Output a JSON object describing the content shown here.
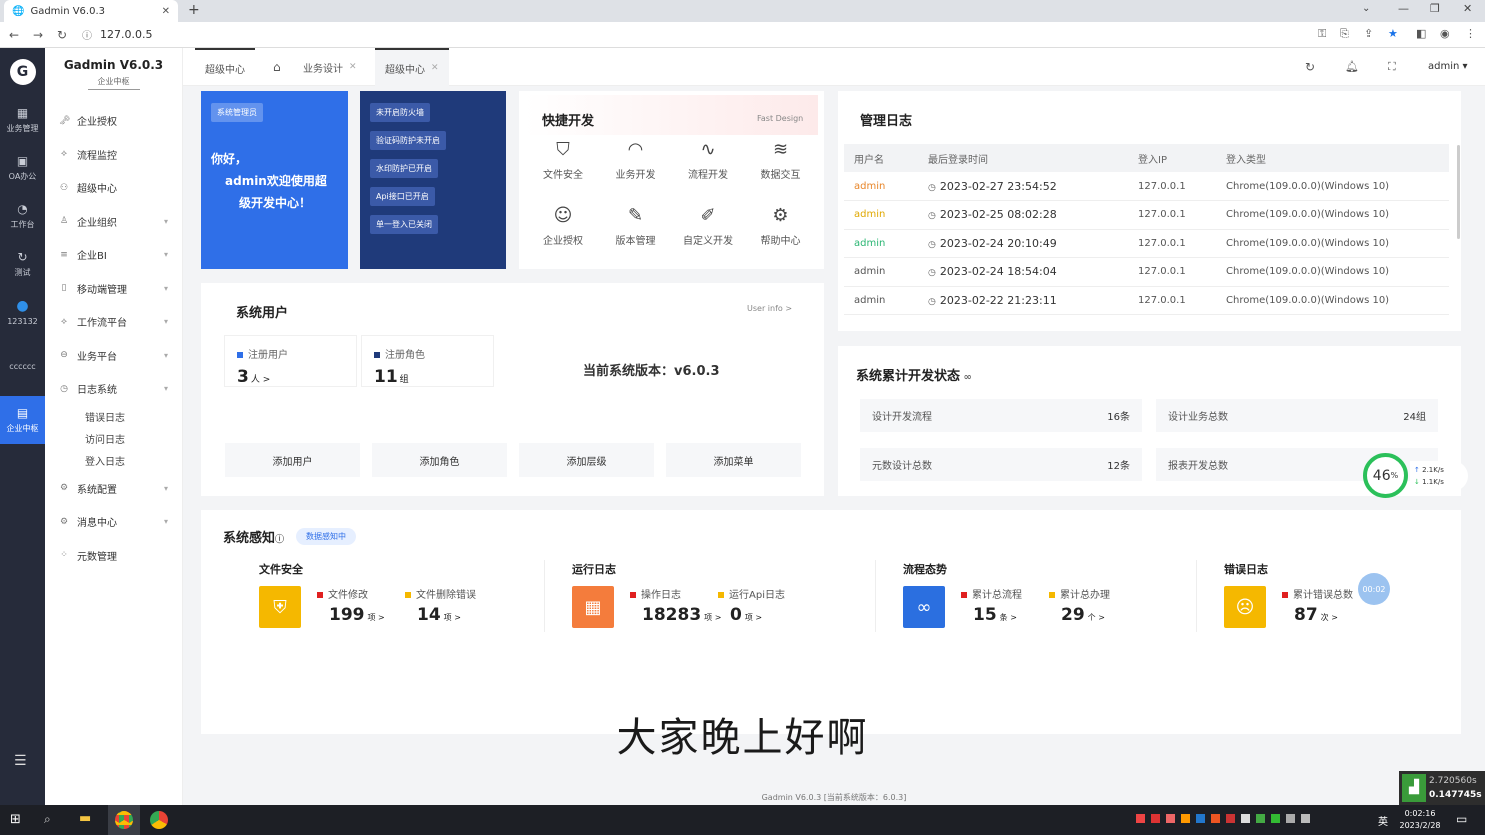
{
  "browser": {
    "tab_title": "Gadmin V6.0.3",
    "new_tab": "+",
    "url": "127.0.0.5"
  },
  "rail": [
    {
      "icon": "grid-icon",
      "label": "业务管理"
    },
    {
      "icon": "monitor-icon",
      "label": "OA办公"
    },
    {
      "icon": "dashboard-icon",
      "label": "工作台"
    },
    {
      "icon": "refresh-icon",
      "label": "测试"
    },
    {
      "icon": "user-circle-icon",
      "label": "123132"
    },
    {
      "icon": "",
      "label": "cccccc"
    },
    {
      "icon": "enterprise-icon",
      "label": "企业中枢"
    }
  ],
  "sidebar": {
    "brand": "Gadmin V6.0.3",
    "brand_sub": "企业中枢",
    "items": [
      {
        "label": "企业授权",
        "arrow": false
      },
      {
        "label": "流程监控",
        "arrow": false
      },
      {
        "label": "超级中心",
        "arrow": false
      },
      {
        "label": "企业组织",
        "arrow": true
      },
      {
        "label": "企业BI",
        "arrow": true
      },
      {
        "label": "移动端管理",
        "arrow": true
      },
      {
        "label": "工作流平台",
        "arrow": true
      },
      {
        "label": "业务平台",
        "arrow": true
      },
      {
        "label": "日志系统",
        "arrow": true
      }
    ],
    "subitems": [
      "错误日志",
      "访问日志",
      "登入日志"
    ],
    "items2": [
      {
        "label": "系统配置",
        "arrow": true
      },
      {
        "label": "消息中心",
        "arrow": true
      },
      {
        "label": "元数管理",
        "arrow": false
      }
    ]
  },
  "header": {
    "tabs": [
      "超级中心",
      "业务设计",
      "超级中心"
    ],
    "user": "admin"
  },
  "welcome": {
    "chip": "系统管理员",
    "line1": "你好，",
    "line2": "admin欢迎使用超级开发中心！"
  },
  "security_chips": [
    "未开启防火墙",
    "验证码防护未开启",
    "水印防护已开启",
    "Api接口已开启",
    "单一登入已关闭"
  ],
  "quick": {
    "title": "快捷开发",
    "sub": "Fast Design",
    "items": [
      "文件安全",
      "业务开发",
      "流程开发",
      "数据交互",
      "企业授权",
      "版本管理",
      "自定义开发",
      "帮助中心"
    ]
  },
  "users": {
    "title": "系统用户",
    "more": "User info >",
    "reg_label": "注册用户",
    "reg_value": "3",
    "reg_unit": "人 >",
    "role_label": "注册角色",
    "role_value": "11",
    "role_unit": "组",
    "version": "当前系统版本：v6.0.3",
    "buttons": [
      "添加用户",
      "添加角色",
      "添加层级",
      "添加菜单"
    ]
  },
  "logs": {
    "title": "管理日志",
    "columns": [
      "用户名",
      "最后登录时间",
      "登入IP",
      "登入类型"
    ],
    "rows": [
      {
        "user": "admin",
        "time": "2023-02-27 23:54:52",
        "ip": "127.0.0.1",
        "type": "Chrome(109.0.0.0)(Windows 10)",
        "color": "#e8862a"
      },
      {
        "user": "admin",
        "time": "2023-02-25 08:02:28",
        "ip": "127.0.0.1",
        "type": "Chrome(109.0.0.0)(Windows 10)",
        "color": "#e0a800"
      },
      {
        "user": "admin",
        "time": "2023-02-24 20:10:49",
        "ip": "127.0.0.1",
        "type": "Chrome(109.0.0.0)(Windows 10)",
        "color": "#2bb673"
      },
      {
        "user": "admin",
        "time": "2023-02-24 18:54:04",
        "ip": "127.0.0.1",
        "type": "Chrome(109.0.0.0)(Windows 10)",
        "color": "#555555"
      },
      {
        "user": "admin",
        "time": "2023-02-22 21:23:11",
        "ip": "127.0.0.1",
        "type": "Chrome(109.0.0.0)(Windows 10)",
        "color": "#555555"
      }
    ]
  },
  "dev": {
    "title": "系统累计开发状态",
    "cells": [
      {
        "label": "设计开发流程",
        "value": "16条"
      },
      {
        "label": "设计业务总数",
        "value": "24组"
      },
      {
        "label": "元数设计总数",
        "value": "12条"
      },
      {
        "label": "报表开发总数",
        "value": ""
      }
    ]
  },
  "perception": {
    "title": "系统感知",
    "badge": "数据感知中",
    "groups": [
      {
        "title": "文件安全",
        "color": "#f5b800",
        "icon": "shield-icon",
        "glyph": "⛨",
        "stats": [
          {
            "label": "文件修改",
            "value": "199",
            "unit": "项 >",
            "dot": "#e02020"
          },
          {
            "label": "文件删除错误",
            "value": "14",
            "unit": "项 >",
            "dot": "#f5b800"
          }
        ]
      },
      {
        "title": "运行日志",
        "color": "#f47c3c",
        "icon": "blocks-icon",
        "glyph": "▦",
        "stats": [
          {
            "label": "操作日志",
            "value": "18283",
            "unit": "项 >",
            "dot": "#e02020"
          },
          {
            "label": "运行Api日志",
            "value": "0",
            "unit": "项 >",
            "dot": "#f5b800"
          }
        ]
      },
      {
        "title": "流程态势",
        "color": "#2b6fe0",
        "icon": "infinity-icon",
        "glyph": "∞",
        "stats": [
          {
            "label": "累计总流程",
            "value": "15",
            "unit": "条 >",
            "dot": "#e02020"
          },
          {
            "label": "累计总办理",
            "value": "29",
            "unit": "个 >",
            "dot": "#f5b800"
          }
        ]
      },
      {
        "title": "错误日志",
        "color": "#f5b800",
        "icon": "sad-face-icon",
        "glyph": "☹",
        "stats": [
          {
            "label": "累计错误总数",
            "value": "87",
            "unit": "次 >",
            "dot": "#e02020"
          }
        ]
      }
    ]
  },
  "widget": {
    "percent": "46",
    "percent_unit": "%",
    "up": "2.1K/s",
    "down": "1.1K/s",
    "timer": "00:02"
  },
  "subtitle": "大家晚上好啊",
  "footer": "Gadmin V6.0.3 [当前系统版本：6.0.3]",
  "perf": {
    "a": "2.720560s",
    "b": "0.147745s"
  },
  "taskbar": {
    "ime": "英",
    "time": "0:02:16",
    "date": "2023/2/28"
  }
}
